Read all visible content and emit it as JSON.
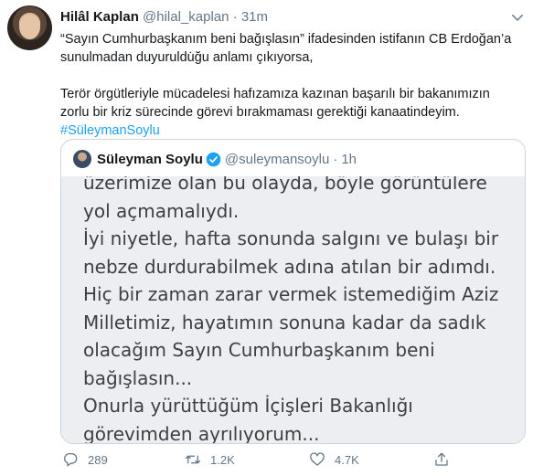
{
  "tweet": {
    "author_name": "Hilâl Kaplan",
    "author_handle": "@hilal_kaplan",
    "separator": "·",
    "time": "31m",
    "text_line1": "“Sayın Cumhurbaşkanım beni bağışlasın” ifadesinden istifanın CB Erdoğan’a",
    "text_line2": "sunulmadan duyuruldu̇ğu anlamı çıkıyorsa,",
    "text_line3": "Terör örgütleriyle mücadelesi hafızamıza kazınan başarılı bir bakanımızın",
    "text_line4": "zorlu bir kriz sürecinde görevi bırakmaması gerektiği kanaatindeyim.",
    "hashtag": "#SüleymanSoylu"
  },
  "quoted": {
    "author_name": "Süleyman Soylu",
    "author_handle": "@suleymansoylu",
    "separator": "·",
    "time": "1h",
    "image_text": [
      "üzerimize olan bu olayda, böyle görüntülere",
      "yol açmamalıydı.",
      "İyi niyetle, hafta sonunda salgını ve bulaşı bir",
      "nebze durdurabilmek adına atılan bir adımdı.",
      "Hiç bir zaman zarar vermek istemediğim Aziz",
      "Milletimiz, hayatımın sonuna kadar da sadık",
      "olacağım Sayın Cumhurbaşkanım beni",
      "bağışlasın...",
      "Onurla yürüttüğüm İçişleri Bakanlığı",
      "görevimden ayrılıyorum..."
    ]
  },
  "actions": {
    "reply_count": "289",
    "retweet_count": "1.2K",
    "like_count": "4.7K"
  },
  "colors": {
    "accent": "#1da1f2",
    "muted": "#657786",
    "border": "#ccd6dd"
  }
}
